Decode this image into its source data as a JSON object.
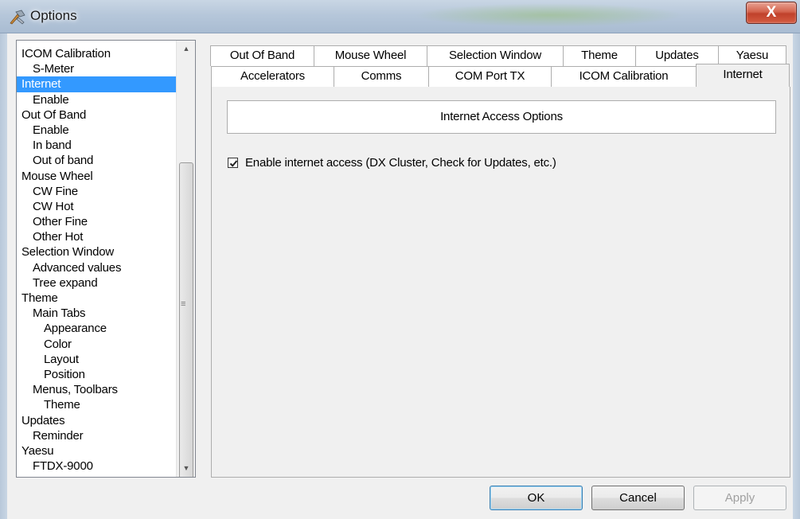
{
  "window": {
    "title": "Options",
    "close_label": "X"
  },
  "tree": {
    "items": [
      {
        "label": "ICOM Calibration",
        "level": 0
      },
      {
        "label": "S-Meter",
        "level": 1
      },
      {
        "label": "Internet",
        "level": 0,
        "selected": true
      },
      {
        "label": "Enable",
        "level": 1
      },
      {
        "label": "Out Of Band",
        "level": 0
      },
      {
        "label": "Enable",
        "level": 1
      },
      {
        "label": "In band",
        "level": 1
      },
      {
        "label": "Out of band",
        "level": 1
      },
      {
        "label": "Mouse Wheel",
        "level": 0
      },
      {
        "label": "CW Fine",
        "level": 1
      },
      {
        "label": "CW Hot",
        "level": 1
      },
      {
        "label": "Other Fine",
        "level": 1
      },
      {
        "label": "Other Hot",
        "level": 1
      },
      {
        "label": "Selection Window",
        "level": 0
      },
      {
        "label": "Advanced values",
        "level": 1
      },
      {
        "label": "Tree expand",
        "level": 1
      },
      {
        "label": "Theme",
        "level": 0
      },
      {
        "label": "Main Tabs",
        "level": 1
      },
      {
        "label": "Appearance",
        "level": 2
      },
      {
        "label": "Color",
        "level": 2
      },
      {
        "label": "Layout",
        "level": 2
      },
      {
        "label": "Position",
        "level": 2
      },
      {
        "label": "Menus, Toolbars",
        "level": 1
      },
      {
        "label": "Theme",
        "level": 2
      },
      {
        "label": "Updates",
        "level": 0
      },
      {
        "label": "Reminder",
        "level": 1
      },
      {
        "label": "Yaesu",
        "level": 0
      },
      {
        "label": "FTDX-9000",
        "level": 1
      }
    ]
  },
  "tabs": {
    "back_row": [
      "Out Of Band",
      "Mouse Wheel",
      "Selection Window",
      "Theme",
      "Updates",
      "Yaesu"
    ],
    "front_row": [
      "Accelerators",
      "Comms",
      "COM Port TX",
      "ICOM Calibration",
      "Internet"
    ],
    "active": "Internet"
  },
  "panel": {
    "header": "Internet Access Options",
    "checkbox_label": "Enable internet access (DX Cluster, Check for Updates, etc.)",
    "checkbox_checked": true
  },
  "buttons": {
    "ok": "OK",
    "cancel": "Cancel",
    "apply": "Apply"
  },
  "colors": {
    "selection": "#3399ff",
    "close_button": "#c94a32"
  }
}
